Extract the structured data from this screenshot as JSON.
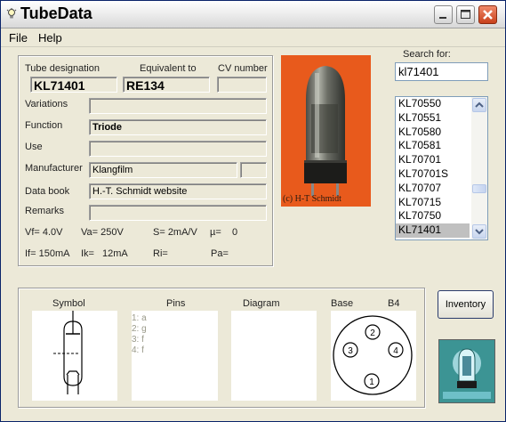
{
  "window": {
    "title": "TubeData"
  },
  "menu": {
    "file": "File",
    "help": "Help"
  },
  "search": {
    "label": "Search for:",
    "value": "kl71401"
  },
  "tube_list": {
    "items": [
      "KL70550",
      "KL70551",
      "KL70580",
      "KL70581",
      "KL70701",
      "KL70701S",
      "KL70707",
      "KL70715",
      "KL70750",
      "KL71401"
    ],
    "selected": "KL71401"
  },
  "details": {
    "designation_label": "Tube designation",
    "equivalent_label": "Equivalent to",
    "cv_label": "CV number",
    "designation_value": "KL71401",
    "equivalent_value": "RE134",
    "cv_value": "",
    "variations_label": "Variations",
    "variations_value": "",
    "function_label": "Function",
    "function_value": "Triode",
    "use_label": "Use",
    "use_value": "",
    "manufacturer_label": "Manufacturer",
    "manufacturer_value": "Klangfilm",
    "manufacturer_extra": "",
    "databook_label": "Data book",
    "databook_value": "H.-T. Schmidt website",
    "remarks_label": "Remarks",
    "remarks_value": ""
  },
  "params": {
    "vf": "Vf= 4.0V",
    "va": "Va= 250V",
    "s": "S= 2mA/V",
    "mu": "µ=",
    "mu_value": "0",
    "if": "If= 150mA",
    "ik": "Ik=",
    "ik_value": "12mA",
    "ri": "Ri=",
    "pa": "Pa="
  },
  "photo": {
    "credit": "(c) H-T Schmidt"
  },
  "bottom": {
    "symbol_label": "Symbol",
    "pins_label": "Pins",
    "diagram_label": "Diagram",
    "base_label": "Base",
    "base_value": "B4",
    "pins": [
      "1: a",
      "2: g",
      "3: f",
      "4: f"
    ],
    "base_pins": [
      "1",
      "2",
      "3",
      "4"
    ]
  },
  "buttons": {
    "inventory": "Inventory"
  },
  "colors": {
    "window_bg": "#ece9d8",
    "photo_bg": "#e85a1c",
    "close_button": "#c8401c",
    "list_selection": "#c0c0c0",
    "logo_bg": "#2e8a8a"
  }
}
